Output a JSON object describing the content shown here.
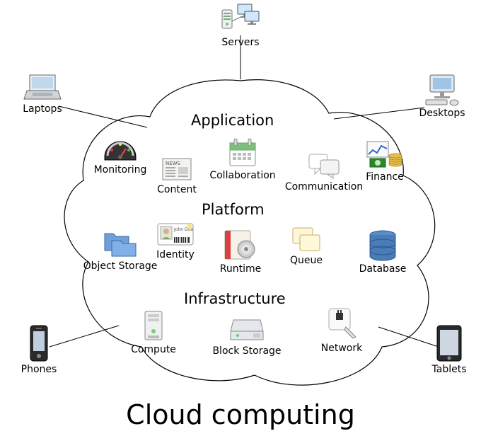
{
  "title": "Cloud computing",
  "layers": {
    "application": "Application",
    "platform": "Platform",
    "infrastructure": "Infrastructure"
  },
  "clients": {
    "servers": "Servers",
    "laptops": "Laptops",
    "desktops": "Desktops",
    "phones": "Phones",
    "tablets": "Tablets"
  },
  "application_tier": {
    "monitoring": "Monitoring",
    "content": "Content",
    "collaboration": "Collaboration",
    "communication": "Communication",
    "finance": "Finance"
  },
  "platform_tier": {
    "object_storage": "Object Storage",
    "identity": "Identity",
    "identity_badge_name": "John Doe",
    "runtime": "Runtime",
    "queue": "Queue",
    "database": "Database"
  },
  "infrastructure_tier": {
    "compute": "Compute",
    "block_storage": "Block Storage",
    "network": "Network"
  },
  "content_badge": "NEWS"
}
